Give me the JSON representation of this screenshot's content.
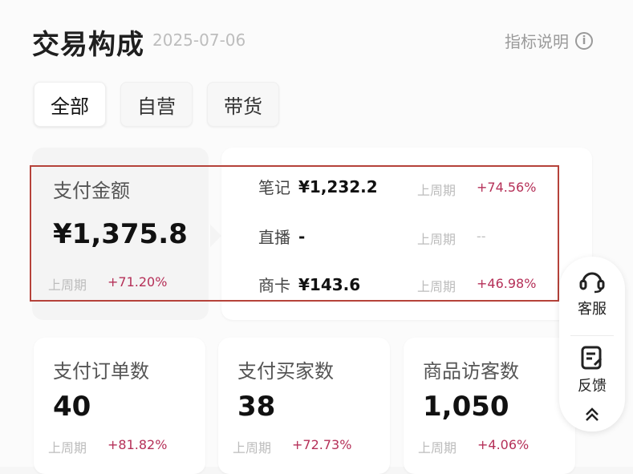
{
  "header": {
    "title": "交易构成",
    "date": "2025-07-06",
    "help_label": "指标说明",
    "help_icon": "info-icon"
  },
  "tabs": [
    {
      "label": "全部",
      "active": true
    },
    {
      "label": "自营",
      "active": false
    },
    {
      "label": "带货",
      "active": false
    }
  ],
  "payment": {
    "label": "支付金额",
    "value": "¥1,375.8",
    "prev_label": "上周期",
    "change": "+71.20%"
  },
  "breakdown": [
    {
      "name": "笔记",
      "value": "¥1,232.2",
      "prev_label": "上周期",
      "change": "+74.56%"
    },
    {
      "name": "直播",
      "value": "-",
      "prev_label": "上周期",
      "change": "--"
    },
    {
      "name": "商卡",
      "value": "¥143.6",
      "prev_label": "上周期",
      "change": "+46.98%"
    }
  ],
  "cards": [
    {
      "label": "支付订单数",
      "value": "40",
      "prev_label": "上周期",
      "change": "+81.82%"
    },
    {
      "label": "支付买家数",
      "value": "38",
      "prev_label": "上周期",
      "change": "+72.73%"
    },
    {
      "label": "商品访客数",
      "value": "1,050",
      "prev_label": "上周期",
      "change": "+4.06%"
    }
  ],
  "floating": {
    "service_label": "客服",
    "feedback_label": "反馈",
    "service_icon": "headset-icon",
    "feedback_icon": "feedback-icon",
    "collapse_icon": "double-chevron-up-icon"
  },
  "colors": {
    "positive": "#b53058",
    "highlight_border": "#b5423a"
  }
}
